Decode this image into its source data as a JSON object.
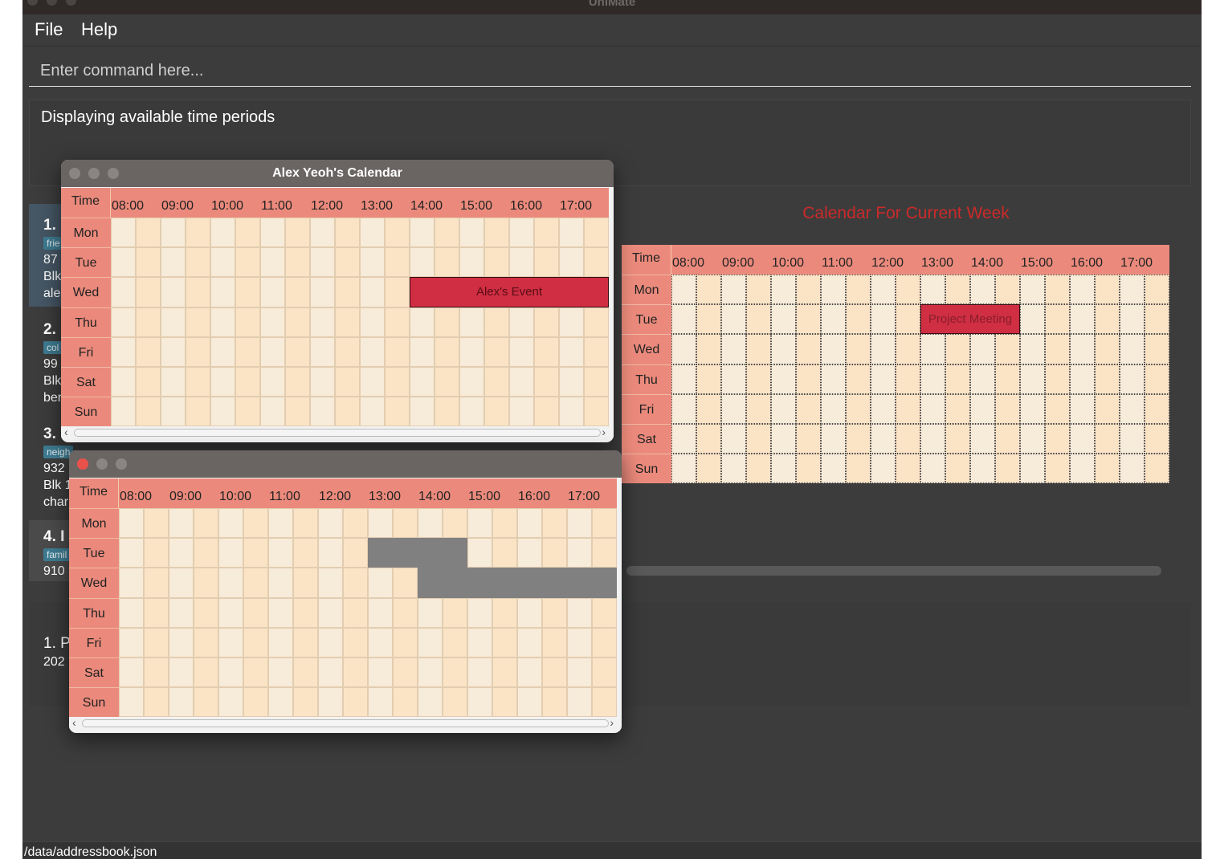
{
  "app": {
    "title": "UniMate"
  },
  "menu": {
    "file": "File",
    "help": "Help"
  },
  "command": {
    "placeholder": "Enter command here..."
  },
  "result": {
    "text": "Displaying available time periods"
  },
  "contacts": [
    {
      "index": "1.",
      "tag": "frie",
      "phone": "87",
      "address": "Blk",
      "email": "ale"
    },
    {
      "index": "2.",
      "tag": "col",
      "phone": "99",
      "address": "Blk",
      "email": "ber"
    },
    {
      "index": "3.",
      "tag": "neigh",
      "phone": "932",
      "address": "Blk 1",
      "email": "char"
    },
    {
      "index": "4. I",
      "tag": "famil",
      "phone": "910"
    }
  ],
  "week_calendar": {
    "title": "Calendar For Current Week",
    "time_header": "Time",
    "hours": [
      "08:00",
      "09:00",
      "10:00",
      "11:00",
      "12:00",
      "13:00",
      "14:00",
      "15:00",
      "16:00",
      "17:00"
    ],
    "days": [
      "Mon",
      "Tue",
      "Wed",
      "Thu",
      "Fri",
      "Sat",
      "Sun"
    ],
    "events": [
      {
        "name": "Project Meeting",
        "day": "Tue",
        "start": "13:00",
        "end": "15:00"
      }
    ]
  },
  "event_list": {
    "index": "1. P",
    "date": "202"
  },
  "popup_alex": {
    "title": "Alex Yeoh's Calendar",
    "time_header": "Time",
    "hours": [
      "08:00",
      "09:00",
      "10:00",
      "11:00",
      "12:00",
      "13:00",
      "14:00",
      "15:00",
      "16:00",
      "17:00"
    ],
    "days": [
      "Mon",
      "Tue",
      "Wed",
      "Thu",
      "Fri",
      "Sat",
      "Sun"
    ],
    "events": [
      {
        "name": "Alex's Event",
        "day": "Wed",
        "start": "14:00",
        "end": "18:00"
      }
    ]
  },
  "popup_free": {
    "title": "",
    "time_header": "Time",
    "hours": [
      "08:00",
      "09:00",
      "10:00",
      "11:00",
      "12:00",
      "13:00",
      "14:00",
      "15:00",
      "16:00",
      "17:00"
    ],
    "days": [
      "Mon",
      "Tue",
      "Wed",
      "Thu",
      "Fri",
      "Sat",
      "Sun"
    ],
    "busy": [
      {
        "day": "Tue",
        "start": "13:00",
        "end": "15:00"
      },
      {
        "day": "Wed",
        "start": "14:00",
        "end": "18:00"
      }
    ]
  },
  "status": {
    "path": "/data/addressbook.json"
  },
  "colors": {
    "header": "#eb8a7c",
    "cell_light": "#f7ebd9",
    "cell_warm": "#fbe3c6",
    "event": "#cf2e43",
    "busy": "#808080",
    "week_title": "#cc2a2a"
  }
}
